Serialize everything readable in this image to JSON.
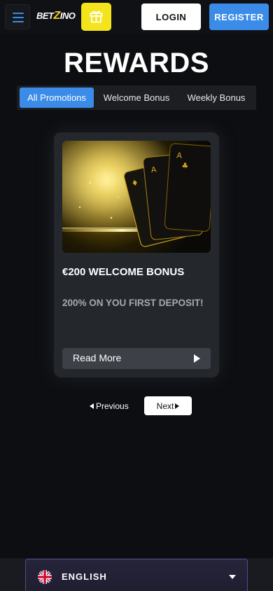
{
  "header": {
    "logo_text_left": "BET",
    "logo_text_z": "Z",
    "logo_text_right": "INO",
    "login_label": "LOGIN",
    "register_label": "REGISTER"
  },
  "page": {
    "title": "REWARDS"
  },
  "tabs": [
    {
      "label": "All Promotions",
      "active": true
    },
    {
      "label": "Welcome Bonus",
      "active": false
    },
    {
      "label": "Weekly Bonus",
      "active": false
    }
  ],
  "promotion": {
    "title": "€200 WELCOME BONUS",
    "subtitle": "200% ON YOU FIRST DEPOSIT!",
    "read_more_label": "Read More"
  },
  "pagination": {
    "prev_label": "Previous",
    "next_label": "Next"
  },
  "footer": {
    "language_label": "ENGLISH"
  },
  "colors": {
    "accent": "#3b8ce8",
    "gift": "#f3e41b",
    "background": "#0d0e11",
    "card": "#24272c"
  },
  "icons": {
    "menu": "hamburger-menu-icon",
    "gift": "gift-icon",
    "read_more": "play-arrow-icon",
    "prev": "triangle-left-icon",
    "next": "triangle-right-icon",
    "flag": "uk-flag-icon",
    "caret": "chevron-down-icon"
  }
}
